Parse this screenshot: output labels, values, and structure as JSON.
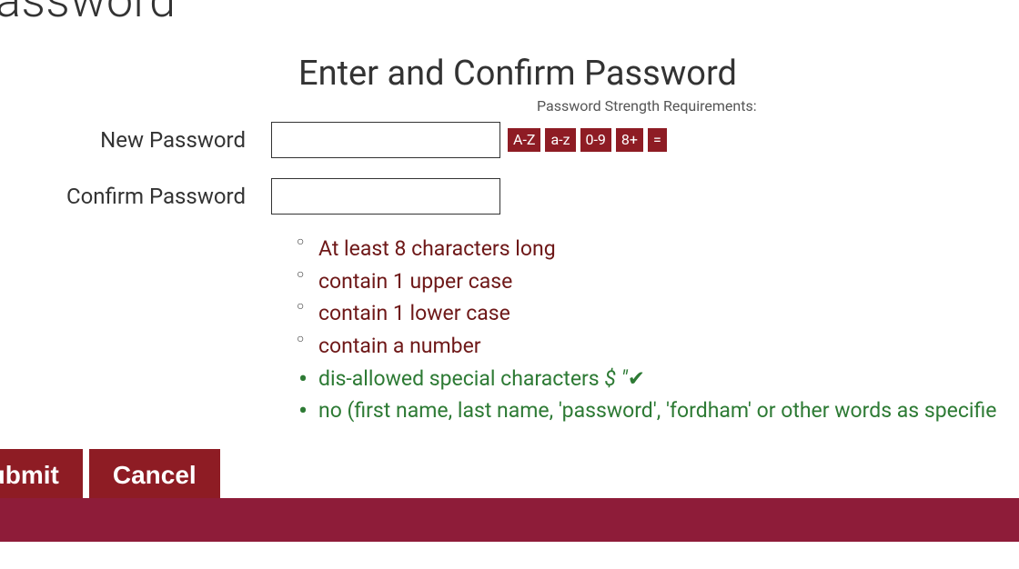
{
  "pageTitle": "w Password",
  "sectionTitle": "Enter and Confirm Password",
  "strengthLabel": "Password Strength Requirements:",
  "labels": {
    "newPassword": "New Password",
    "confirmPassword": "Confirm Password"
  },
  "badges": {
    "upper": "A-Z",
    "lower": "a-z",
    "digit": "0-9",
    "length": "8+",
    "equal": "="
  },
  "requirements": {
    "r1": "At least 8 characters long",
    "r2": "contain 1 upper case",
    "r3": "contain 1 lower case",
    "r4": "contain a number",
    "r5_text": "dis-allowed special characters ",
    "r5_italic": "$ \"",
    "r5_check": "✔",
    "r6": "no (first name, last name, 'password', 'fordham' or other words as specifie"
  },
  "buttons": {
    "submit": "Submit",
    "cancel": "Cancel"
  }
}
